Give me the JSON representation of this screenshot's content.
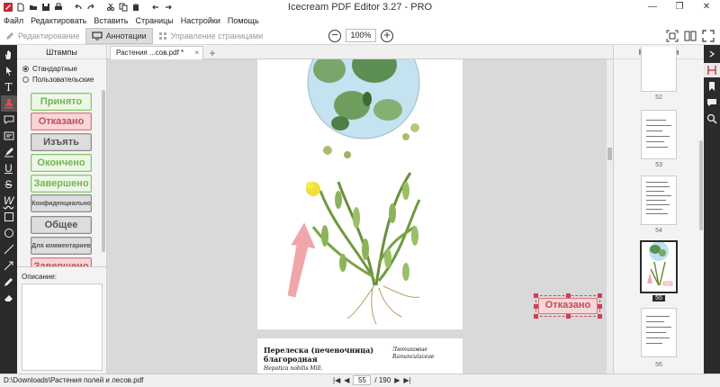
{
  "app": {
    "title": "Icecream PDF Editor 3.27 - PRO"
  },
  "window_controls": {
    "minimize": "—",
    "maximize": "❐",
    "close": "✕"
  },
  "menu": [
    "Файл",
    "Редактировать",
    "Вставить",
    "Страницы",
    "Настройки",
    "Помощь"
  ],
  "modes": [
    {
      "label": "Редактирование",
      "icon": "pencil-icon",
      "active": false
    },
    {
      "label": "Аннотации",
      "icon": "monitor-icon",
      "active": true
    },
    {
      "label": "Управление страницами",
      "icon": "grid-icon",
      "active": false
    }
  ],
  "zoom": {
    "value": "100%",
    "minus": "−",
    "plus": "+"
  },
  "stamps_panel": {
    "title": "Штампы",
    "radio": [
      {
        "label": "Стандартные",
        "checked": true
      },
      {
        "label": "Пользовательские",
        "checked": false
      }
    ],
    "items": [
      {
        "label": "Принято",
        "style": "g"
      },
      {
        "label": "Отказано",
        "style": "r"
      },
      {
        "label": "Изъять",
        "style": "k"
      },
      {
        "label": "Окончено",
        "style": "g"
      },
      {
        "label": "Завершено",
        "style": "g"
      },
      {
        "label": "Конфиденциально",
        "style": "k"
      },
      {
        "label": "Общее",
        "style": "k"
      },
      {
        "label": "Для комментариев",
        "style": "k"
      },
      {
        "label": "Завершено",
        "style": "r"
      }
    ]
  },
  "description": {
    "label": "Описание:"
  },
  "doc_tab": {
    "name": "Растения ...сов.pdf *",
    "close": "×",
    "add": "+"
  },
  "page_content": {
    "stamp_on_page": "Отказано",
    "title_line1": "Перелеска (печеночница)",
    "title_line2": "благородная",
    "latin": "Hepatica nobilis Mill.",
    "family_ru": "Лютиковые",
    "family_lat": "Ranunculaceae"
  },
  "navigation": {
    "title": "Навигация",
    "thumbs": [
      {
        "label": "52",
        "selected": false
      },
      {
        "label": "53",
        "selected": false
      },
      {
        "label": "54",
        "selected": false
      },
      {
        "label": "55",
        "selected": true
      },
      {
        "label": "56",
        "selected": false
      }
    ]
  },
  "status": {
    "path": "D:\\Downloads\\Растения полей и лесов.pdf",
    "current_page": "55",
    "total_pages": "/ 190"
  },
  "colors": {
    "accent_red": "#c2262e",
    "stamp_green": "#74b54f",
    "stamp_red": "#c34a52",
    "dark_toolbar": "#2b2b2b"
  }
}
